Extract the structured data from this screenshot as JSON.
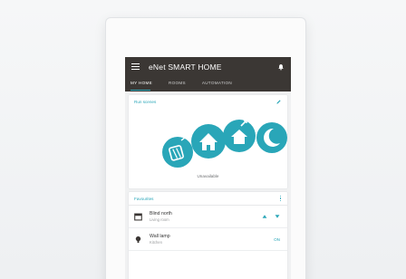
{
  "app": {
    "title": "eNet SMART HOME"
  },
  "tabs": [
    {
      "label": "MY HOME",
      "active": true
    },
    {
      "label": "ROOMS",
      "active": false
    },
    {
      "label": "AUTOMATION",
      "active": false
    }
  ],
  "scenes_card": {
    "title": "Run scenes",
    "status": "Unavailable",
    "scene_icons": [
      "suitcase-icon",
      "home-icon",
      "house-up-icon",
      "moon-icon"
    ]
  },
  "favourites_card": {
    "title": "Favourites",
    "devices": [
      {
        "name": "Blind north",
        "room": "Living room",
        "icon": "blind-icon"
      },
      {
        "name": "Wall lamp",
        "room": "Kitchen",
        "icon": "lamp-icon",
        "state": "ON"
      }
    ]
  },
  "colors": {
    "header_bg": "#3b3734",
    "accent": "#29a6b8",
    "screen_bg": "#f0f1f2"
  }
}
